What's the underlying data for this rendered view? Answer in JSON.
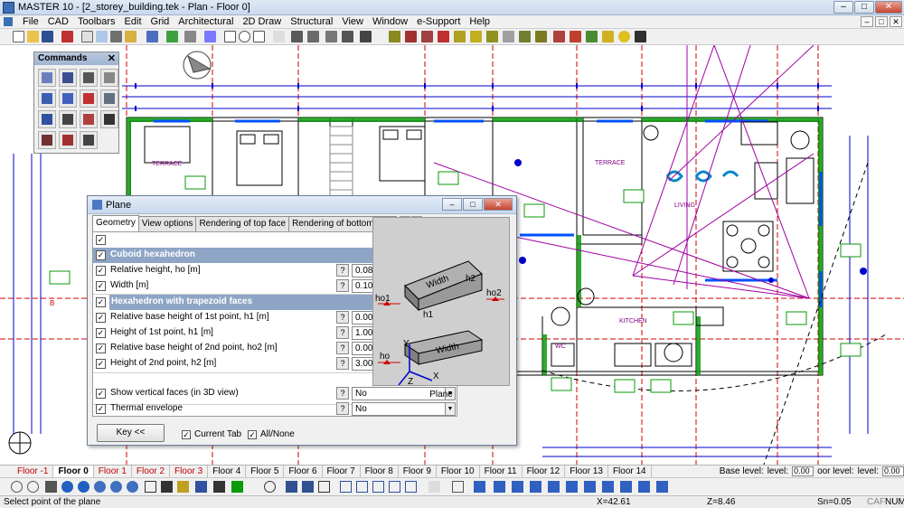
{
  "window": {
    "title": "MASTER 10 - [2_storey_building.tek - Plan - Floor 0]",
    "min": "–",
    "max": "□",
    "close": "✕"
  },
  "menu": {
    "items": [
      "File",
      "CAD",
      "Toolbars",
      "Edit",
      "Grid",
      "Architectural",
      "2D Draw",
      "Structural",
      "View",
      "Window",
      "e-Support",
      "Help"
    ]
  },
  "commands": {
    "title": "Commands",
    "close": "✕"
  },
  "plan": {
    "room_labels": [
      "TERRACE",
      "TERRACE",
      "LIVING",
      "KITCHEN",
      "WC"
    ],
    "marker": "B"
  },
  "dialog": {
    "title": "Plane",
    "tabs": [
      "Geometry",
      "View options",
      "Rendering of top face",
      "Rendering of bottom face"
    ],
    "tab_prev": "◀",
    "tab_next": "▶",
    "sections": {
      "cuboid": "Cuboid hexahedron",
      "trapezoid": "Hexahedron with trapezoid faces"
    },
    "rows": [
      {
        "label": "Relative height, ho [m]",
        "value": "0.08"
      },
      {
        "label": "Width [m]",
        "value": "0.10"
      },
      {
        "label": "Relative base height of 1st point, h1 [m]",
        "value": "0.000"
      },
      {
        "label": "Height of 1st point, h1 [m]",
        "value": "1.000"
      },
      {
        "label": "Relative base height of 2nd point, ho2 [m]",
        "value": "0.000"
      },
      {
        "label": "Height of 2nd point, h2 [m]",
        "value": "3.000"
      },
      {
        "label": "Show vertical faces (in 3D view)",
        "value": "No"
      },
      {
        "label": "Thermal envelope",
        "value": "No"
      }
    ],
    "help": "?",
    "dropdown": "▼",
    "check": "✓",
    "preview_labels": {
      "width_top": "Width",
      "h2": "h2",
      "ho2": "ho2",
      "ho1": "ho1",
      "h1": "h1",
      "ho": "ho",
      "width_bottom": "Width",
      "y": "Y",
      "x": "X",
      "z": "Z"
    },
    "preview_caption": "Plane",
    "key_button": "Key <<",
    "current_tab": "Current Tab",
    "all_none": "All/None"
  },
  "floors": {
    "tabs": [
      "Floor -1",
      "Floor 0",
      "Floor 1",
      "Floor 2",
      "Floor 3",
      "Floor 4",
      "Floor 5",
      "Floor 6",
      "Floor 7",
      "Floor 8",
      "Floor 9",
      "Floor 10",
      "Floor 11",
      "Floor 12",
      "Floor 13",
      "Floor 14"
    ],
    "active_index": 1,
    "red_indexes": [
      0,
      2,
      3,
      4
    ],
    "base_level_label": "Base level:",
    "level_label": "level:",
    "level_value": "0.00",
    "floor_level_label": "oor level:",
    "level_label_2": "level:",
    "level_value_2": "0.00"
  },
  "status": {
    "prompt": "Select point of the plane",
    "x": "X=42.61",
    "z": "Z=8.46",
    "sn": "Sn=0.05",
    "caf": "CAF",
    "num": "NUM"
  },
  "colors": {
    "wall_green": "#0a9a0a",
    "dimension_blue": "#0000cc",
    "magenta": "#a000a0",
    "red_axis": "#d00000",
    "section_header": "#8ea5c6"
  }
}
